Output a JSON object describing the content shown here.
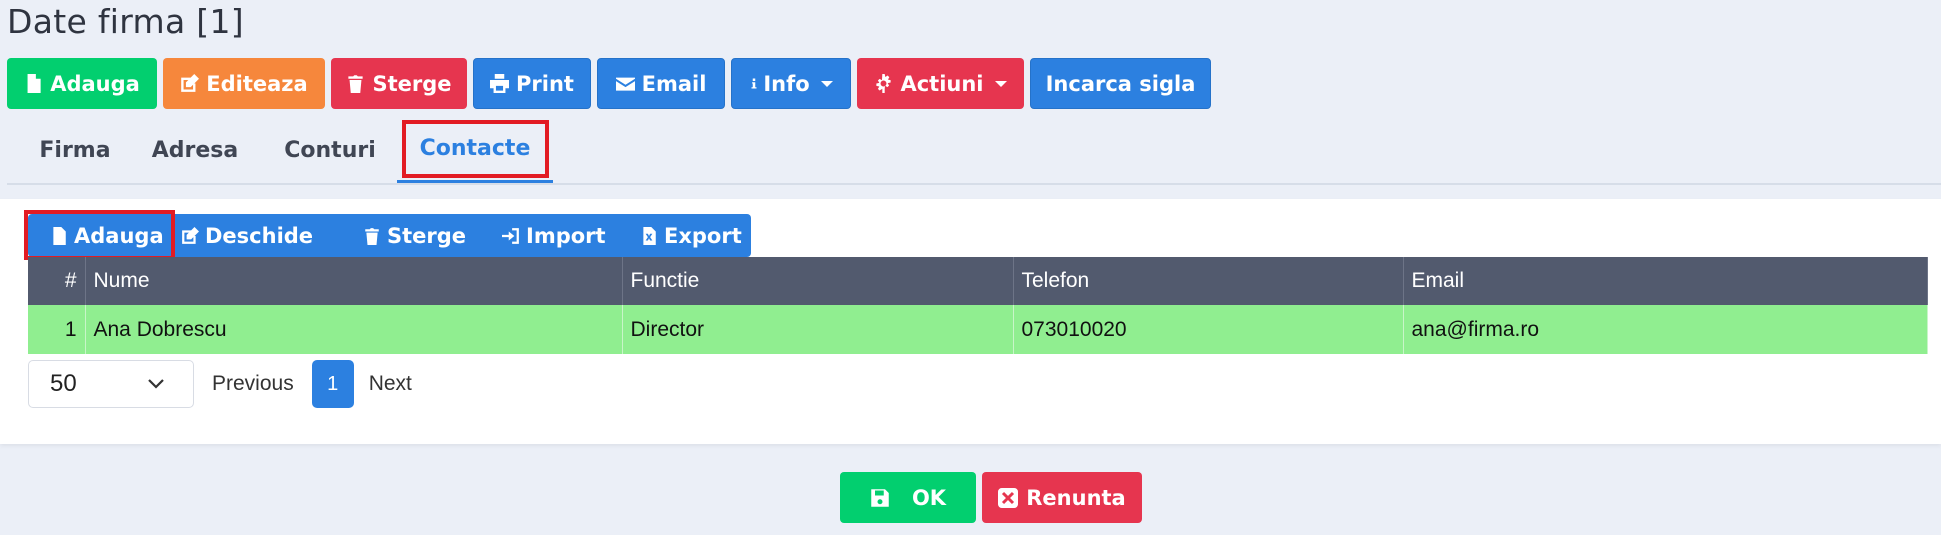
{
  "page": {
    "title": "Date firma [1]"
  },
  "toolbar": {
    "adauga": "Adauga",
    "editeaza": "Editeaza",
    "sterge": "Sterge",
    "print": "Print",
    "email": "Email",
    "info": "Info",
    "actiuni": "Actiuni",
    "incarca_sigla": "Incarca sigla"
  },
  "tabs": [
    "Firma",
    "Adresa",
    "Conturi",
    "Contacte"
  ],
  "active_tab": "Contacte",
  "subtoolbar": {
    "adauga": "Adauga",
    "deschide": "Deschide",
    "sterge": "Sterge",
    "import": "Import",
    "export": "Export"
  },
  "table": {
    "columns": [
      "#",
      "Nume",
      "Functie",
      "Telefon",
      "Email"
    ],
    "rows": [
      {
        "num": "1",
        "nume": "Ana Dobrescu",
        "functie": "Director",
        "telefon": "073010020",
        "email": "ana@firma.ro"
      }
    ]
  },
  "pager": {
    "page_size": "50",
    "previous": "Previous",
    "current_page": "1",
    "next": "Next"
  },
  "footer": {
    "ok": "OK",
    "renunta": "Renunta"
  },
  "colors": {
    "primary": "#2c80e0",
    "success": "#02cf6f",
    "warning": "#f6873c",
    "danger": "#e6354f",
    "row_highlight": "#90ee90",
    "header_bg": "#525a6e",
    "highlight_box": "#e21b23"
  },
  "icons": [
    "file-icon",
    "edit-icon",
    "trash-icon",
    "print-icon",
    "envelope-icon",
    "info-icon",
    "gear-icon",
    "import-icon",
    "excel-icon",
    "save-icon",
    "close-icon",
    "chevron-down-icon"
  ]
}
